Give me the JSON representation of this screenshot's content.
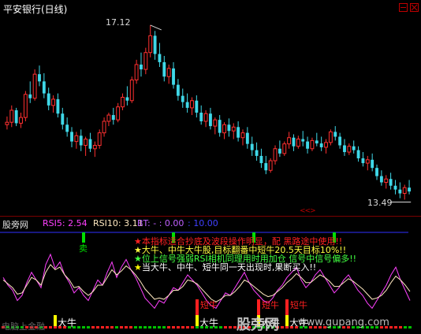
{
  "window": {
    "title": "平安银行(日线)"
  },
  "price_chart": {
    "high_label": "17.12",
    "low_label": "13.49",
    "nav_arrows": "<<>",
    "candles": [
      [
        15.05,
        15.22,
        14.95,
        15.1
      ],
      [
        15.1,
        15.45,
        15.0,
        15.35
      ],
      [
        15.35,
        15.4,
        15.02,
        15.08
      ],
      [
        15.08,
        15.3,
        14.98,
        15.2
      ],
      [
        15.2,
        15.75,
        15.12,
        15.68
      ],
      [
        15.68,
        15.95,
        15.5,
        15.6
      ],
      [
        15.6,
        16.2,
        15.55,
        16.1
      ],
      [
        16.1,
        16.28,
        15.85,
        15.95
      ],
      [
        15.95,
        16.12,
        15.6,
        15.7
      ],
      [
        15.7,
        15.82,
        15.35,
        15.45
      ],
      [
        15.45,
        15.66,
        15.3,
        15.58
      ],
      [
        15.58,
        15.7,
        15.2,
        15.28
      ],
      [
        15.28,
        15.4,
        14.95,
        15.05
      ],
      [
        15.05,
        15.2,
        14.8,
        14.9
      ],
      [
        14.9,
        15.0,
        14.58,
        14.7
      ],
      [
        14.7,
        14.9,
        14.55,
        14.82
      ],
      [
        14.82,
        14.95,
        14.5,
        14.62
      ],
      [
        14.62,
        14.8,
        14.4,
        14.75
      ],
      [
        14.75,
        14.88,
        14.48,
        14.55
      ],
      [
        14.55,
        14.7,
        14.38,
        14.62
      ],
      [
        14.62,
        14.95,
        14.55,
        14.88
      ],
      [
        14.88,
        15.2,
        14.8,
        15.12
      ],
      [
        15.12,
        15.3,
        15.02,
        15.25
      ],
      [
        15.25,
        15.4,
        15.05,
        15.15
      ],
      [
        15.15,
        15.5,
        15.1,
        15.42
      ],
      [
        15.42,
        15.7,
        15.35,
        15.62
      ],
      [
        15.62,
        15.85,
        15.45,
        15.55
      ],
      [
        15.55,
        16.05,
        15.5,
        15.98
      ],
      [
        15.98,
        16.4,
        15.9,
        16.3
      ],
      [
        16.3,
        16.55,
        16.05,
        16.2
      ],
      [
        16.2,
        16.65,
        16.1,
        16.55
      ],
      [
        16.55,
        17.12,
        16.45,
        16.9
      ],
      [
        16.9,
        17.0,
        16.4,
        16.52
      ],
      [
        16.52,
        16.75,
        16.25,
        16.35
      ],
      [
        16.35,
        16.48,
        15.95,
        16.05
      ],
      [
        16.05,
        16.3,
        15.9,
        16.22
      ],
      [
        16.22,
        16.35,
        15.8,
        15.88
      ],
      [
        15.88,
        16.0,
        15.55,
        15.65
      ],
      [
        15.65,
        15.8,
        15.4,
        15.52
      ],
      [
        15.52,
        15.7,
        15.3,
        15.4
      ],
      [
        15.4,
        15.62,
        15.25,
        15.55
      ],
      [
        15.55,
        15.66,
        15.2,
        15.3
      ],
      [
        15.3,
        15.45,
        15.05,
        15.12
      ],
      [
        15.12,
        15.35,
        15.0,
        15.28
      ],
      [
        15.28,
        15.4,
        14.95,
        15.02
      ],
      [
        15.02,
        15.2,
        14.85,
        15.15
      ],
      [
        15.15,
        15.25,
        14.8,
        14.88
      ],
      [
        14.88,
        15.1,
        14.75,
        15.05
      ],
      [
        15.05,
        15.18,
        14.8,
        14.92
      ],
      [
        14.92,
        15.08,
        14.75,
        15.0
      ],
      [
        15.0,
        15.12,
        14.7,
        14.78
      ],
      [
        14.78,
        14.95,
        14.62,
        14.88
      ],
      [
        14.88,
        15.0,
        14.55,
        14.65
      ],
      [
        14.65,
        14.8,
        14.4,
        14.52
      ],
      [
        14.52,
        14.68,
        14.3,
        14.4
      ],
      [
        14.4,
        14.55,
        14.15,
        14.25
      ],
      [
        14.25,
        14.4,
        14.02,
        14.1
      ],
      [
        14.1,
        14.35,
        14.05,
        14.3
      ],
      [
        14.3,
        14.62,
        14.22,
        14.55
      ],
      [
        14.55,
        14.72,
        14.38,
        14.45
      ],
      [
        14.45,
        14.7,
        14.4,
        14.65
      ],
      [
        14.65,
        14.9,
        14.55,
        14.78
      ],
      [
        14.78,
        14.85,
        14.5,
        14.6
      ],
      [
        14.6,
        14.82,
        14.55,
        14.75
      ],
      [
        14.75,
        14.92,
        14.6,
        14.7
      ],
      [
        14.7,
        14.8,
        14.45,
        14.55
      ],
      [
        14.55,
        14.78,
        14.5,
        14.72
      ],
      [
        14.72,
        14.88,
        14.6,
        14.66
      ],
      [
        14.66,
        14.8,
        14.5,
        14.58
      ],
      [
        14.58,
        14.75,
        14.45,
        14.68
      ],
      [
        14.68,
        14.95,
        14.62,
        14.9
      ],
      [
        14.9,
        15.02,
        14.72,
        14.8
      ],
      [
        14.8,
        14.88,
        14.55,
        14.62
      ],
      [
        14.62,
        14.75,
        14.4,
        14.48
      ],
      [
        14.48,
        14.66,
        14.42,
        14.6
      ],
      [
        14.6,
        14.72,
        14.45,
        14.52
      ],
      [
        14.52,
        14.6,
        14.28,
        14.35
      ],
      [
        14.35,
        14.48,
        14.18,
        14.25
      ],
      [
        14.25,
        14.4,
        14.1,
        14.32
      ],
      [
        14.32,
        14.45,
        14.08,
        14.15
      ],
      [
        14.15,
        14.22,
        13.9,
        13.98
      ],
      [
        13.98,
        14.1,
        13.78,
        13.85
      ],
      [
        13.85,
        14.0,
        13.72,
        13.92
      ],
      [
        13.92,
        14.05,
        13.7,
        13.78
      ],
      [
        13.78,
        13.9,
        13.6,
        13.7
      ],
      [
        13.7,
        13.85,
        13.52,
        13.62
      ],
      [
        13.62,
        13.8,
        13.49,
        13.74
      ],
      [
        13.74,
        13.9,
        13.6,
        13.66
      ]
    ]
  },
  "indicator": {
    "name": "股旁网",
    "rsi5": "RSI5: 2.54",
    "rsi10": "RSI10: 3.11",
    "bt": "BT: - : 0.00",
    "level": ": 10.00",
    "annotations": [
      {
        "text": "本指标适合抄底及波段操作明显，配 黑路途中使用!!",
        "color": "#ff2020"
      },
      {
        "text": "大牛、中牛大牛股,目标翻番中短牛20.5天目标10%!!",
        "color": "#ffff40"
      },
      {
        "text": "位上信号强弱RSI相机同理用时用加仓 信号中信号偏多!!",
        "color": "#40ff40"
      },
      {
        "text": "当大牛、中牛、短牛同一天出现时,果断买入!!",
        "color": "#ffffff"
      }
    ],
    "sell_label": "卖",
    "short_bull_label": "短牛",
    "big_bull_label": "大牛",
    "bottom_left_text": "电脑上金融",
    "rsi5_series": [
      48,
      42,
      38,
      30,
      34,
      44,
      52,
      46,
      40,
      58,
      66,
      55,
      60,
      50,
      44,
      36,
      40,
      34,
      30,
      38,
      46,
      42,
      52,
      60,
      48,
      56,
      62,
      54,
      48,
      40,
      32,
      28,
      24,
      30,
      28,
      34,
      40,
      38,
      44,
      50,
      46,
      42,
      36,
      30,
      26,
      24,
      30,
      36,
      34,
      40,
      46,
      52,
      44,
      38,
      34,
      30,
      28,
      32,
      38,
      42,
      48,
      52,
      56,
      46,
      40,
      44,
      50,
      54,
      48,
      42,
      36,
      40,
      46,
      50,
      44,
      38,
      34,
      28,
      24,
      30,
      36,
      42,
      50,
      56,
      46,
      38,
      30
    ],
    "rsi10_series": [
      46,
      43,
      40,
      35,
      36,
      42,
      48,
      46,
      42,
      52,
      58,
      54,
      56,
      50,
      46,
      40,
      41,
      37,
      34,
      37,
      42,
      42,
      48,
      54,
      50,
      53,
      57,
      54,
      50,
      45,
      39,
      35,
      31,
      32,
      31,
      34,
      38,
      38,
      41,
      46,
      45,
      43,
      39,
      35,
      31,
      29,
      31,
      34,
      34,
      37,
      41,
      46,
      44,
      41,
      38,
      35,
      33,
      34,
      37,
      40,
      44,
      47,
      51,
      48,
      44,
      44,
      47,
      50,
      48,
      45,
      41,
      41,
      44,
      47,
      45,
      42,
      39,
      35,
      31,
      32,
      34,
      38,
      44,
      49,
      46,
      42,
      37
    ],
    "sell_positions": [
      17,
      36,
      53,
      70
    ],
    "short_bull_positions": [
      41,
      54,
      60
    ],
    "big_bull_positions": [
      11,
      41,
      54,
      60
    ]
  },
  "colors": {
    "up": "#ff3030",
    "down": "#3fd8e8",
    "rsi5": "#ff40ff",
    "rsi10": "#ffe8c0",
    "signal_green": "#00e000",
    "signal_yellow": "#ffff00",
    "level_line": "#3030ff"
  },
  "watermark": {
    "cn": "股旁网",
    "url": "www.gupang.com"
  }
}
